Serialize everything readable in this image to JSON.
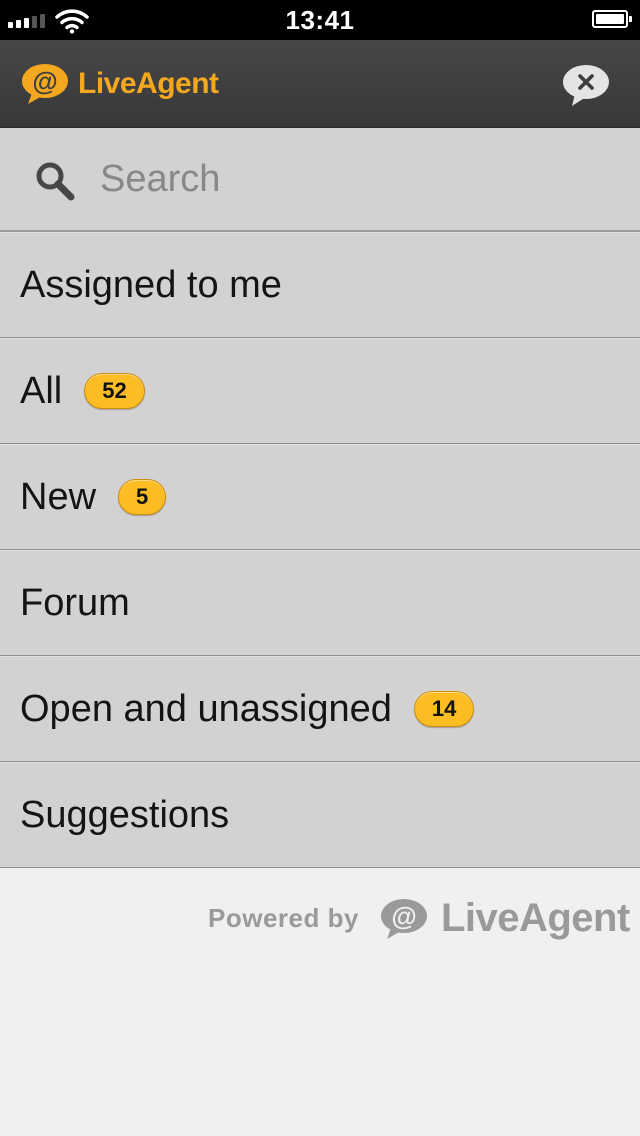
{
  "status_bar": {
    "time": "13:41",
    "signal_bars": 3,
    "battery_level": 1.0,
    "icons": [
      "signal-icon",
      "wifi-icon",
      "battery-icon"
    ]
  },
  "header": {
    "logo_text": "LiveAgent",
    "logo_icon": "at-speech-bubble-icon",
    "close_icon": "close-chat-icon"
  },
  "search": {
    "placeholder": "Search",
    "value": "",
    "icon": "search-icon"
  },
  "menu": {
    "items": [
      {
        "label": "Assigned to me"
      },
      {
        "label": "All",
        "count": "52"
      },
      {
        "label": "New",
        "count": "5"
      },
      {
        "label": "Forum"
      },
      {
        "label": "Open and unassigned",
        "count": "14"
      },
      {
        "label": "Suggestions"
      }
    ]
  },
  "footer": {
    "powered_by": "Powered by",
    "brand": "LiveAgent"
  },
  "colors": {
    "brand_orange": "#f4a81f",
    "badge_yellow": "#fbbd23",
    "header_bg": "#3f3f3f",
    "menu_bg": "#d2d2d2",
    "page_bg": "#f0f0f0"
  }
}
